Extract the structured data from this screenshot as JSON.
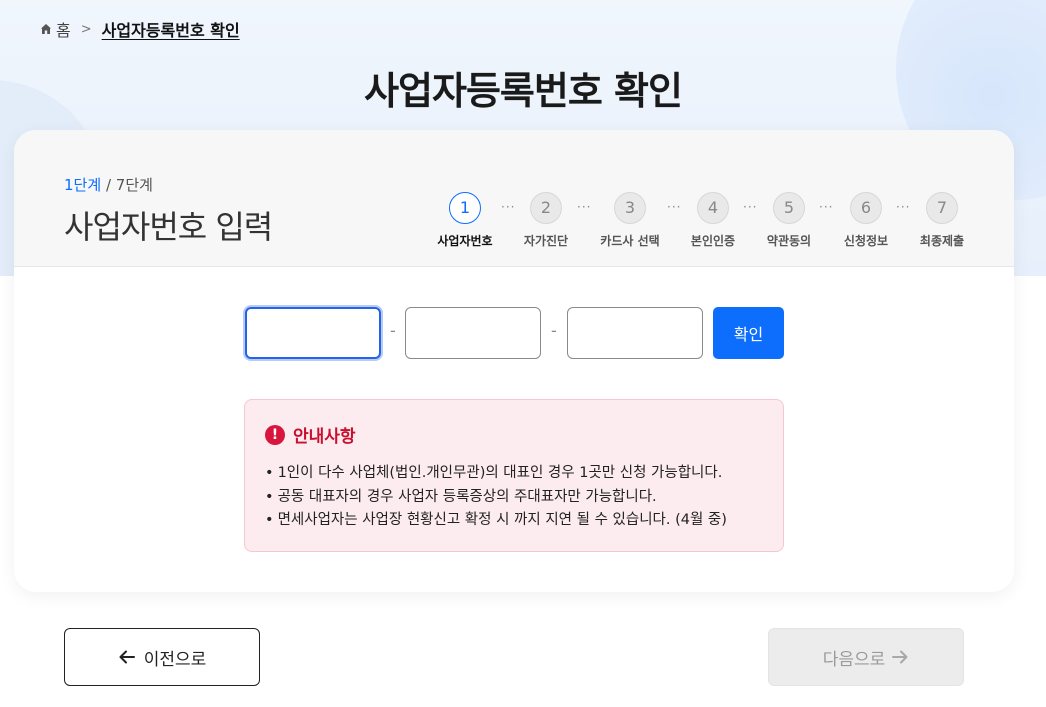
{
  "breadcrumb": {
    "home_icon": "home-icon",
    "home_label": "홈",
    "separator": ">",
    "current": "사업자등록번호 확인"
  },
  "page": {
    "title": "사업자등록번호 확인"
  },
  "step_indicator": {
    "current": "1단계",
    "sep": "/",
    "total": "7단계"
  },
  "section": {
    "title": "사업자번호 입력"
  },
  "steps": [
    {
      "num": "1",
      "label": "사업자번호",
      "active": true
    },
    {
      "num": "2",
      "label": "자가진단",
      "active": false
    },
    {
      "num": "3",
      "label": "카드사 선택",
      "active": false
    },
    {
      "num": "4",
      "label": "본인인증",
      "active": false
    },
    {
      "num": "5",
      "label": "약관동의",
      "active": false
    },
    {
      "num": "6",
      "label": "신청정보",
      "active": false
    },
    {
      "num": "7",
      "label": "최종제출",
      "active": false
    }
  ],
  "step_dots": "···",
  "form": {
    "part1_value": "",
    "part2_value": "",
    "part3_value": "",
    "dash": "-",
    "confirm_label": "확인"
  },
  "notice": {
    "icon": "alert-icon",
    "title": "안내사항",
    "items": [
      "1인이 다수 사업체(법인.개인무관)의 대표인 경우 1곳만 신청 가능합니다.",
      "공동 대표자의 경우 사업자 등록증상의 주대표자만 가능합니다.",
      "면세사업자는 사업장 현황신고 확정 시 까지 지연 될 수 있습니다. (4월 중)"
    ]
  },
  "nav": {
    "prev_label": "이전으로",
    "next_label": "다음으로",
    "next_disabled": true
  },
  "colors": {
    "accent": "#0d6efd",
    "notice_bg": "#fdecef",
    "notice_title": "#c8102e",
    "disabled_bg": "#ececec"
  }
}
